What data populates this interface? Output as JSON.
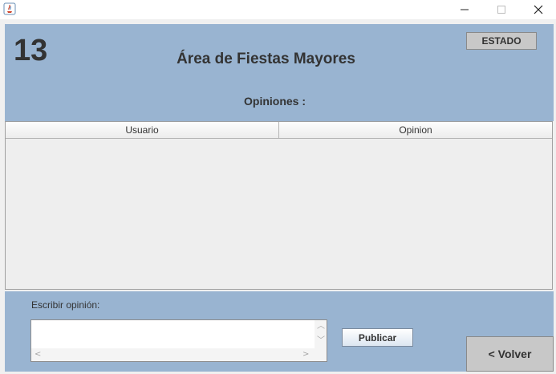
{
  "window": {
    "min_glyph": "—",
    "max_glyph": "☐",
    "close_glyph": "✕"
  },
  "header": {
    "number": "13",
    "title": "Área de Fiestas Mayores",
    "estado_label": "ESTADO",
    "opiniones_label": "Opiniones :"
  },
  "table": {
    "columns": [
      "Usuario",
      "Opinion"
    ],
    "rows": []
  },
  "compose": {
    "label": "Escribir opinión:",
    "value": "",
    "publish_label": "Publicar"
  },
  "footer": {
    "back_label": "< Volver"
  },
  "colors": {
    "panel_blue": "#99b4d1",
    "background": "#f0f0f0"
  }
}
